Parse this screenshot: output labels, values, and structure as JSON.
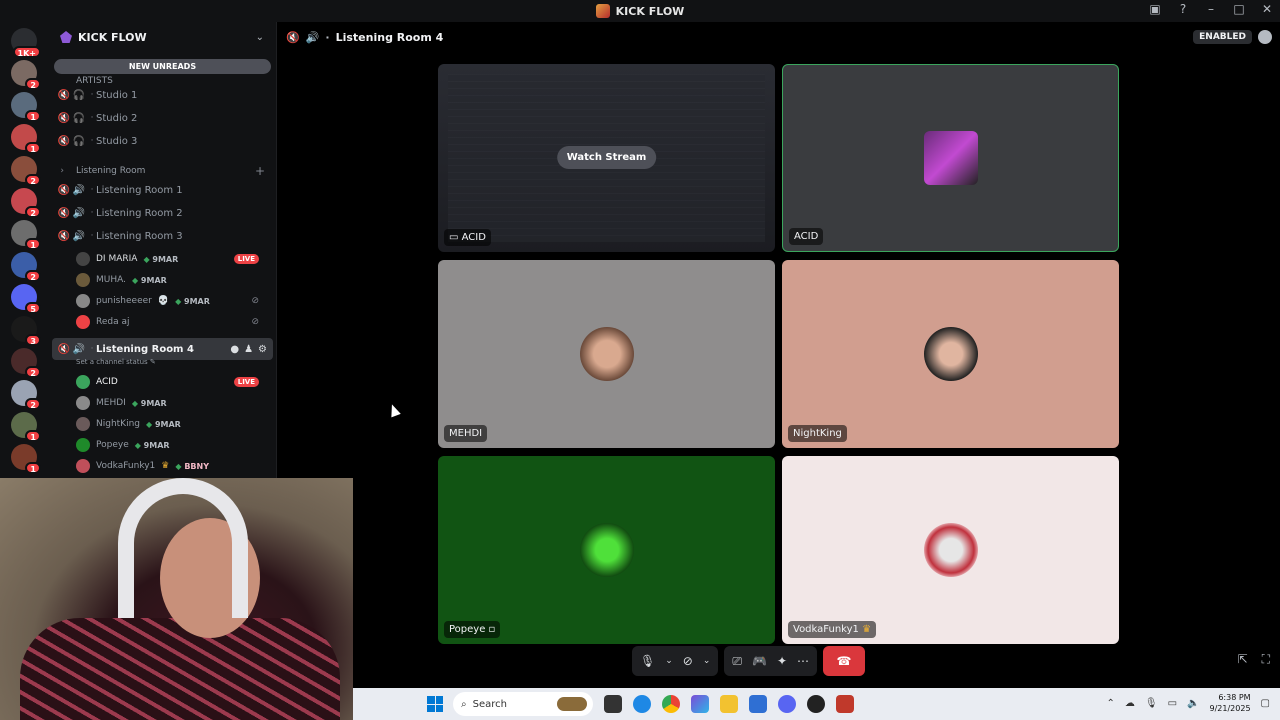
{
  "window": {
    "title": "KICK FLOW"
  },
  "server_rail": {
    "top_badge": "1K+",
    "badges": [
      "2",
      "1",
      "1",
      "2",
      "2",
      "1",
      "2",
      "5",
      "3",
      "2",
      "2",
      "1",
      "1"
    ]
  },
  "sidebar": {
    "guild_name": "KICK FLOW",
    "new_unreads": "NEW UNREADS",
    "category_artists": "ARTISTS",
    "studios": [
      "Studio 1",
      "Studio 2",
      "Studio 3"
    ],
    "category_listening": "Listening Room",
    "listening_rooms": [
      "Listening Room 1",
      "Listening Room 2",
      "Listening Room 3"
    ],
    "room3_members": [
      {
        "name": "DI MARIA",
        "tag": "9MAR",
        "live": "LIVE"
      },
      {
        "name": "MUHA.",
        "tag": "9MAR"
      },
      {
        "name": "punisheeeer",
        "tag": "9MAR"
      },
      {
        "name": "Reda aj",
        "tag": ""
      }
    ],
    "active_room": "Listening Room 4",
    "status_hint": "Set a channel status",
    "room4_members": [
      {
        "name": "ACID",
        "tag": "",
        "live": "LIVE"
      },
      {
        "name": "MEHDI",
        "tag": "9MAR"
      },
      {
        "name": "NightKing",
        "tag": "9MAR"
      },
      {
        "name": "Popeye",
        "tag": "9MAR"
      },
      {
        "name": "VodkaFunky1",
        "tag": "BBNY"
      }
    ]
  },
  "voice": {
    "channel_title": "Listening Room 4",
    "enabled_label": "ENABLED",
    "watch_stream": "Watch Stream",
    "tiles": [
      {
        "name": "ACID",
        "bg": "#2b2d31"
      },
      {
        "name": "ACID",
        "bg": "#3a3c3f"
      },
      {
        "name": "MEHDI",
        "bg": "#8f8d8d"
      },
      {
        "name": "NightKing",
        "bg": "#d19e8f"
      },
      {
        "name": "Popeye",
        "bg": "#115413"
      },
      {
        "name": "VodkaFunky1",
        "bg": "#f2e7e7"
      }
    ]
  },
  "taskbar": {
    "search_placeholder": "Search",
    "time": "6:38 PM",
    "date": "9/21/2025"
  },
  "colors": {
    "accent": "#5865f2",
    "live": "#ed4245",
    "hangup": "#da373c",
    "speaking": "#3ba55d"
  }
}
